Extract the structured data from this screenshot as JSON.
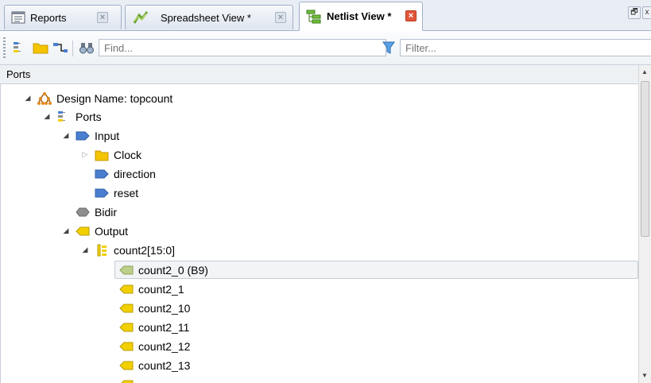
{
  "tabs": [
    {
      "label": "Reports",
      "icon": "report-icon",
      "active": false
    },
    {
      "label": "Spreadsheet View *",
      "icon": "spreadsheet-icon",
      "active": false
    },
    {
      "label": "Netlist View *",
      "icon": "netlist-icon",
      "active": true
    }
  ],
  "window_controls": {
    "restore": "🗗",
    "close": "x"
  },
  "toolbar": {
    "find_placeholder": "Find...",
    "filter_placeholder": "Filter..."
  },
  "panel": {
    "title": "Ports"
  },
  "tree": [
    {
      "label": "Design Name: topcount",
      "icon": "design-icon",
      "expanded": true
    },
    {
      "label": "Ports",
      "icon": "ports-icon",
      "expanded": true
    },
    {
      "label": "Input",
      "icon": "input-port-icon",
      "expanded": true
    },
    {
      "label": "Clock",
      "icon": "folder-icon",
      "expanded": false
    },
    {
      "label": "direction",
      "icon": "input-port-icon"
    },
    {
      "label": "reset",
      "icon": "input-port-icon"
    },
    {
      "label": "Bidir",
      "icon": "bidir-port-icon"
    },
    {
      "label": "Output",
      "icon": "output-port-icon",
      "expanded": true
    },
    {
      "label": "count2[15:0]",
      "icon": "bus-icon",
      "expanded": true
    },
    {
      "label": "count2_0 (B9)",
      "icon": "output-port-icon",
      "selected": true
    },
    {
      "label": "count2_1",
      "icon": "output-port-icon"
    },
    {
      "label": "count2_10",
      "icon": "output-port-icon"
    },
    {
      "label": "count2_11",
      "icon": "output-port-icon"
    },
    {
      "label": "count2_12",
      "icon": "output-port-icon"
    },
    {
      "label": "count2_13",
      "icon": "output-port-icon"
    }
  ],
  "colors": {
    "input": "#4a7fd0",
    "output": "#f2d000",
    "folder": "#f5c400",
    "accent_close": "#e2563c"
  }
}
